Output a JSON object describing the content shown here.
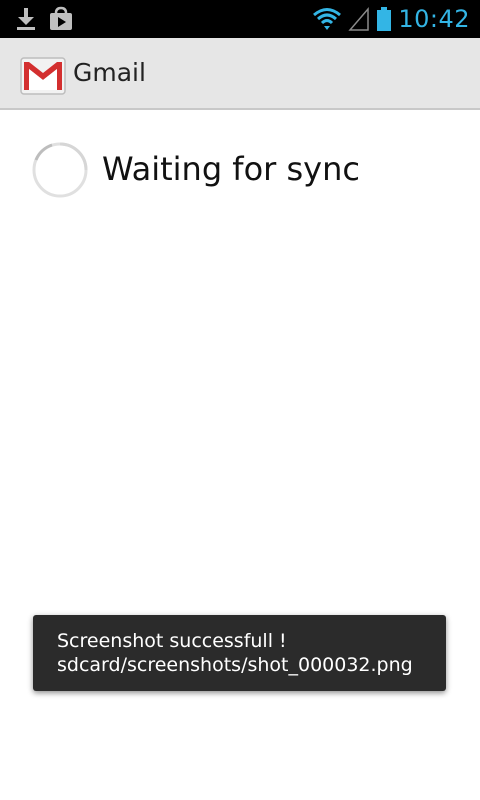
{
  "status_bar": {
    "time": "10:42",
    "accent_color": "#33b5e5",
    "left_icons": [
      "download-icon",
      "play-store-icon"
    ],
    "right_icons": [
      "wifi-icon",
      "signal-icon",
      "battery-icon"
    ]
  },
  "action_bar": {
    "app_icon": "gmail-logo-icon",
    "title": "Gmail"
  },
  "content": {
    "sync_message": "Waiting for sync",
    "spinner_icon": "loading-spinner-icon"
  },
  "toast": {
    "line1": "Screenshot successfull !",
    "line2": "sdcard/screenshots/shot_000032.png"
  }
}
